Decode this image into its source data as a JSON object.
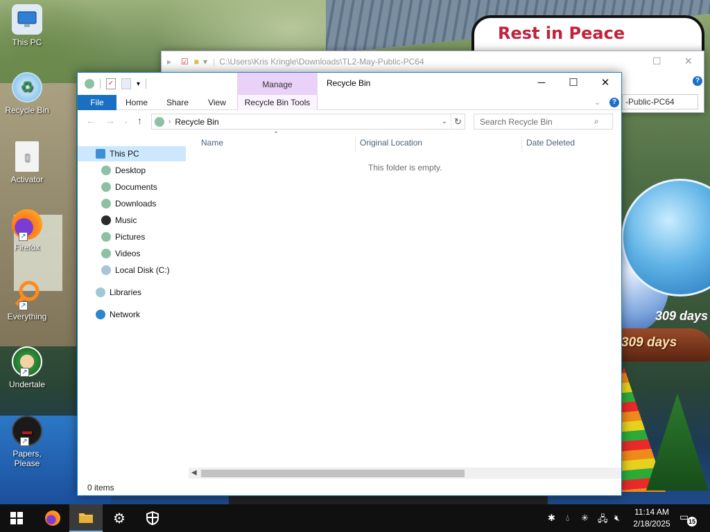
{
  "desktop": {
    "sign_text": "Rest in Peace",
    "days_label_1": "309 days",
    "days_label_2": "309 days",
    "icons": [
      {
        "label": "This PC"
      },
      {
        "label": "Recycle Bin"
      },
      {
        "label": "Activator"
      },
      {
        "label": "Firefox"
      },
      {
        "label": "Everything"
      },
      {
        "label": "Undertale"
      },
      {
        "label": "Papers, Please"
      }
    ]
  },
  "back_window": {
    "path": "C:\\Users\\Kris Kringle\\Downloads\\TL2-May-Public-PC64",
    "address_tail": "-Public-PC64"
  },
  "window": {
    "title": "Recycle Bin",
    "contextual_tab": "Manage",
    "ribbon_tabs": [
      "File",
      "Home",
      "Share",
      "View",
      "Recycle Bin Tools"
    ],
    "address": "Recycle Bin",
    "search_placeholder": "Search Recycle Bin",
    "nav_pane": [
      {
        "label": "This PC"
      },
      {
        "label": "Desktop"
      },
      {
        "label": "Documents"
      },
      {
        "label": "Downloads"
      },
      {
        "label": "Music"
      },
      {
        "label": "Pictures"
      },
      {
        "label": "Videos"
      },
      {
        "label": "Local Disk (C:)"
      },
      {
        "label": "Libraries"
      },
      {
        "label": "Network"
      }
    ],
    "columns": [
      "Name",
      "Original Location",
      "Date Deleted"
    ],
    "empty_message": "This folder is empty.",
    "status": "0 items",
    "selected_nav": "This PC"
  },
  "taskbar": {
    "time": "11:14 AM",
    "date": "2/18/2025",
    "notification_count": "15"
  },
  "colors": {
    "accent": "#1a6fc3",
    "manage_tab": "#ead1f7",
    "selection": "#cce8ff",
    "taskbar": "#101010"
  }
}
